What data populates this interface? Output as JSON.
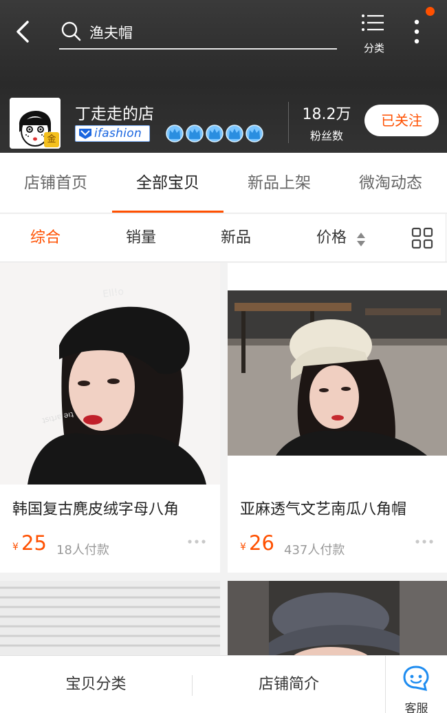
{
  "header": {
    "search_text": "渔夫帽",
    "category_label": "分类"
  },
  "shop": {
    "name": "丁走走的店",
    "badge": "金",
    "brand_tag": "ifashion",
    "crowns": 5,
    "fans_count": "18.2万",
    "fans_label": "粉丝数",
    "follow_label": "已关注"
  },
  "tabs": [
    "店铺首页",
    "全部宝贝",
    "新品上架",
    "微淘动态"
  ],
  "active_tab": 1,
  "sort": {
    "items": [
      "综合",
      "销量",
      "新品",
      "价格"
    ],
    "active": 0
  },
  "products": [
    {
      "title": "韩国复古麂皮绒字母八角",
      "currency": "¥",
      "price": "25",
      "sold": "18人付款"
    },
    {
      "title": "亚麻透气文艺南瓜八角帽",
      "currency": "¥",
      "price": "26",
      "sold": "437人付款"
    }
  ],
  "bottom_bar": {
    "categories": "宝贝分类",
    "intro": "店铺简介",
    "service": "客服"
  },
  "colors": {
    "accent": "#ff5000",
    "header_bg": "#2e2e2e"
  }
}
